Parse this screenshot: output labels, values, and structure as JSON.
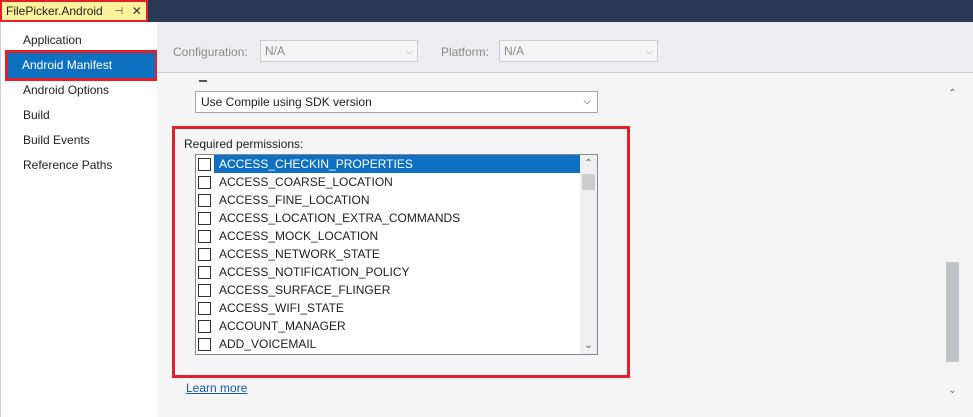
{
  "document_tab": {
    "title": "FilePicker.Android",
    "pin_glyph": "⊣",
    "close_glyph": "✕"
  },
  "sidebar": {
    "items": [
      {
        "label": "Application"
      },
      {
        "label": "Android Manifest",
        "selected": true
      },
      {
        "label": "Android Options"
      },
      {
        "label": "Build"
      },
      {
        "label": "Build Events"
      },
      {
        "label": "Reference Paths"
      }
    ]
  },
  "config_bar": {
    "configuration_label": "Configuration:",
    "configuration_value": "N/A",
    "platform_label": "Platform:",
    "platform_value": "N/A"
  },
  "target_sdk": {
    "value": "Use Compile using SDK version"
  },
  "permissions": {
    "label": "Required permissions:",
    "items": [
      {
        "name": "ACCESS_CHECKIN_PROPERTIES",
        "selected": true,
        "checked": false
      },
      {
        "name": "ACCESS_COARSE_LOCATION",
        "checked": false
      },
      {
        "name": "ACCESS_FINE_LOCATION",
        "checked": false
      },
      {
        "name": "ACCESS_LOCATION_EXTRA_COMMANDS",
        "checked": false
      },
      {
        "name": "ACCESS_MOCK_LOCATION",
        "checked": false
      },
      {
        "name": "ACCESS_NETWORK_STATE",
        "checked": false
      },
      {
        "name": "ACCESS_NOTIFICATION_POLICY",
        "checked": false
      },
      {
        "name": "ACCESS_SURFACE_FLINGER",
        "checked": false
      },
      {
        "name": "ACCESS_WIFI_STATE",
        "checked": false
      },
      {
        "name": "ACCOUNT_MANAGER",
        "checked": false
      },
      {
        "name": "ADD_VOICEMAIL",
        "checked": false
      }
    ]
  },
  "learn_more": "Learn more",
  "colors": {
    "accent": "#0e70c0",
    "tab_bar": "#293955",
    "active_tab": "#fff29d",
    "highlight": "#e0202a"
  }
}
